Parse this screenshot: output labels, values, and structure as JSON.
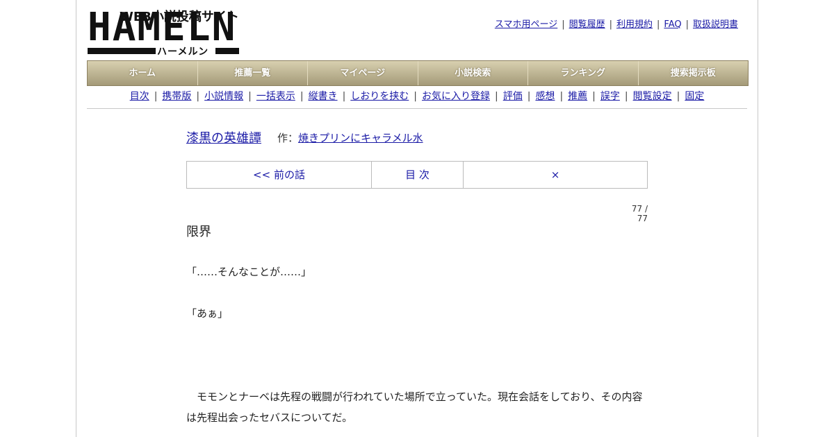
{
  "site": {
    "tagline": "WEB小説投稿サイト",
    "logo_text": "HAMELN",
    "logo_kana": "ハーメルン"
  },
  "toplinks": [
    "スマホ用ページ",
    "閲覧履歴",
    "利用規約",
    "FAQ",
    "取扱説明書"
  ],
  "mainnav": [
    "ホーム",
    "推薦一覧",
    "マイページ",
    "小説検索",
    "ランキング",
    "捜索掲示板"
  ],
  "subnav": [
    "目次",
    "携帯版",
    "小説情報",
    "一括表示",
    "縦書き",
    "しおりを挟む",
    "お気に入り登録",
    "評価",
    "感想",
    "推薦",
    "誤字",
    "閲覧設定",
    "固定"
  ],
  "novel": {
    "title": "漆黒の英雄譚",
    "author_prefix": "作：",
    "author": "焼きプリンにキャラメル水"
  },
  "pager": {
    "prev": "<< 前の話",
    "toc": "目 次",
    "next": "×"
  },
  "count": "77 / 77",
  "chapter_title": "限界",
  "lines": [
    "「……そんなことが……」",
    "「あぁ」",
    "　モモンとナーベは先程の戦闘が行われていた場所で立っていた。現在会話をしており、その内容は先程出会ったセバスについてだ。"
  ]
}
